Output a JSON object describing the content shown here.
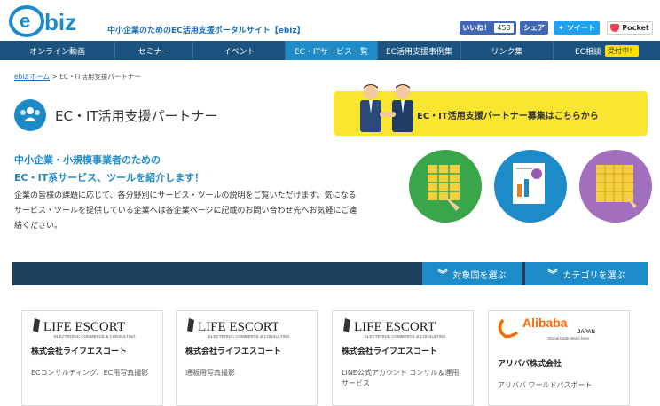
{
  "header": {
    "tagline": "中小企業のためのEC活用支援ポータルサイト【ebiz】",
    "fb_like": "いいね！",
    "fb_like_count": "453",
    "fb_share": "シェア",
    "tweet": "ツイート",
    "pocket": "Pocket"
  },
  "nav": [
    {
      "label": "オンライン動画"
    },
    {
      "label": "セミナー"
    },
    {
      "label": "イベント"
    },
    {
      "label": "EC・ITサービス一覧"
    },
    {
      "label": "EC活用支援事例集"
    },
    {
      "label": "リンク集"
    },
    {
      "label": "EC相談"
    }
  ],
  "nav_badge": "受付中！",
  "breadcrumb": {
    "home": "ebiz ホーム",
    "sep": ">",
    "current": "EC・IT活用支援パートナー"
  },
  "page_title": "EC・IT活用支援パートナー",
  "recruit_banner": "EC・IT活用支援パートナー募集はこちらから",
  "lead": {
    "line1": "中小企業・小規模事業者のための",
    "line2": "EC・IT系サービス、ツールを紹介します！",
    "desc": "企業の皆様の課題に応じて、各分野別にサービス・ツールの説明をご覧いただけます。気になるサービス・ツールを提供している企業へは各企業ページに記載のお問い合わせ先へお気軽にご連絡ください。"
  },
  "filters": {
    "country": "対象国を選ぶ",
    "category": "カテゴリを選ぶ"
  },
  "cards": [
    {
      "logo": "LIFE ESCORT",
      "logo_sub": "ELECTRONIC COMMERCE & CONSULTING",
      "name": "株式会社ライフエスコート",
      "desc": "ECコンサルティング、EC用写真撮影"
    },
    {
      "logo": "LIFE ESCORT",
      "logo_sub": "ELECTRONIC COMMERCE & CONSULTING",
      "name": "株式会社ライフエスコート",
      "desc": "通販用写真撮影"
    },
    {
      "logo": "LIFE ESCORT",
      "logo_sub": "ELECTRONIC COMMERCE & CONSULTING",
      "name": "株式会社ライフエスコート",
      "desc": "LINE公式アカウント コンサル＆運用サービス"
    },
    {
      "logo": "Alibaba",
      "logo_sub": "JAPAN",
      "logo_tag": "Global trade starts here.",
      "name": "アリババ株式会社",
      "desc": "アリババ ワールドパスポート"
    }
  ],
  "colors": {
    "nav": "#1a5280",
    "accent": "#1e8bc9",
    "banner": "#fae631",
    "filter_bar": "#1c3f5e",
    "alibaba": "#ff6a00"
  }
}
